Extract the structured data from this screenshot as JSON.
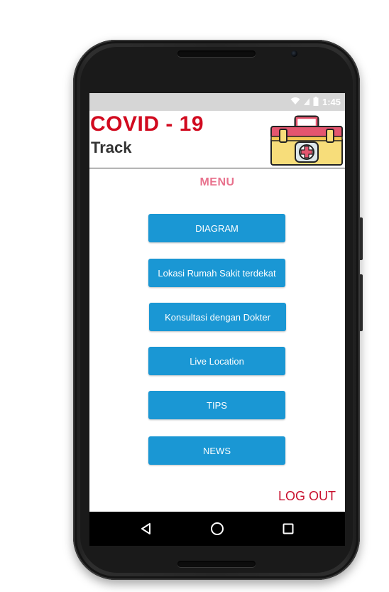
{
  "status_bar": {
    "time": "1:45",
    "icons": [
      "wifi-icon",
      "signal-icon",
      "battery-icon"
    ]
  },
  "header": {
    "title": "COVID - 19",
    "subtitle": "Track",
    "logo_icon": "first-aid-kit-icon"
  },
  "menu": {
    "title": "MENU",
    "buttons": [
      {
        "label": "DIAGRAM"
      },
      {
        "label": "Lokasi Rumah Sakit terdekat"
      },
      {
        "label": "Konsultasi dengan Dokter"
      },
      {
        "label": "Live Location"
      },
      {
        "label": "TIPS"
      },
      {
        "label": "NEWS"
      }
    ],
    "logout_label": "LOG OUT"
  },
  "navigation_bar": {
    "buttons": [
      "back-icon",
      "home-icon",
      "recents-icon"
    ]
  },
  "colors": {
    "title_red": "#d10a1f",
    "menu_pink": "#e8728d",
    "button_blue": "#1a97d4",
    "logout_red": "#c8102e",
    "status_bar_gray": "#d6d6d6"
  }
}
